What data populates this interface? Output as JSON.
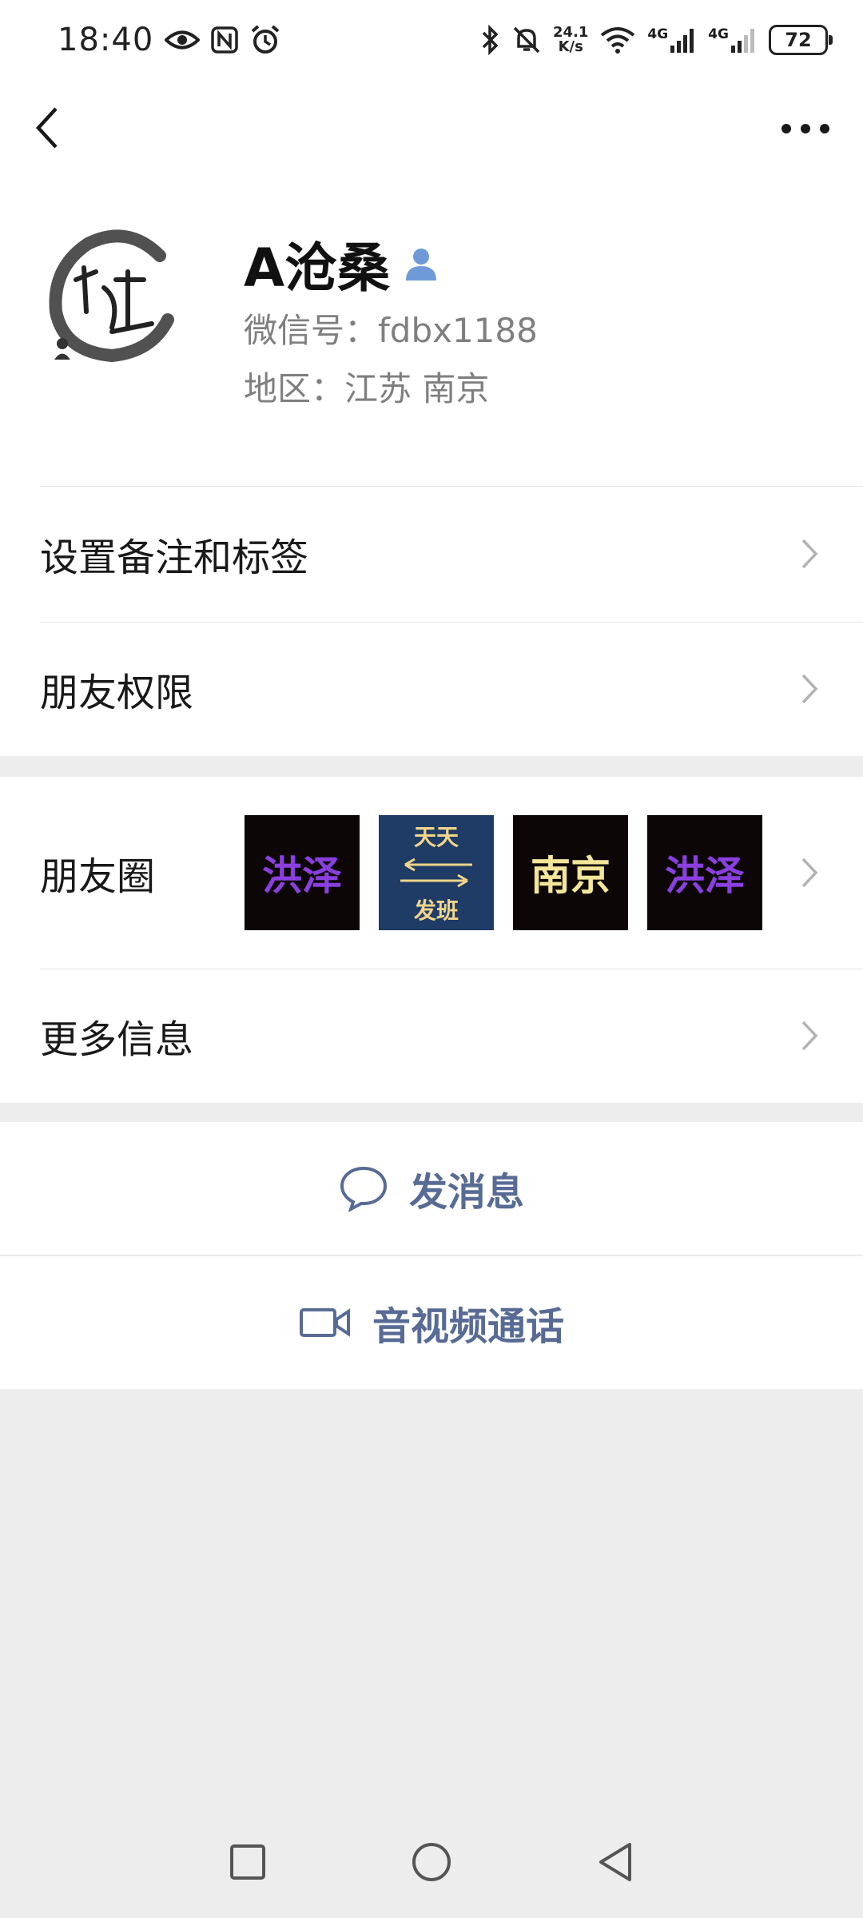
{
  "status_bar": {
    "time": "18:40",
    "net_speed_value": "24.1",
    "net_speed_unit": "K/s",
    "network_label_1": "4G",
    "network_label_2": "4G",
    "battery": "72"
  },
  "profile": {
    "nickname": "A沧桑",
    "wechat_id": "微信号：fdbx1188",
    "region": "地区：江苏  南京",
    "avatar_icon": "zen-brush-circle-logo"
  },
  "cells": {
    "remark_tags": "设置备注和标签",
    "friend_permissions": "朋友权限",
    "moments": "朋友圈",
    "more_info": "更多信息"
  },
  "moments_thumbs": [
    {
      "text": "洪泽",
      "color": "#8a3fe0"
    },
    {
      "top": "天天",
      "bottom": "发班"
    },
    {
      "text": "南京",
      "color": "#f3e59a"
    },
    {
      "text": "洪泽",
      "color": "#8a3fe0"
    }
  ],
  "actions": {
    "send_message": "发消息",
    "av_call": "音视频通话"
  },
  "colors": {
    "accent": "#576b95",
    "page_bg": "#ededed",
    "verified_icon": "#6e9ad8"
  }
}
